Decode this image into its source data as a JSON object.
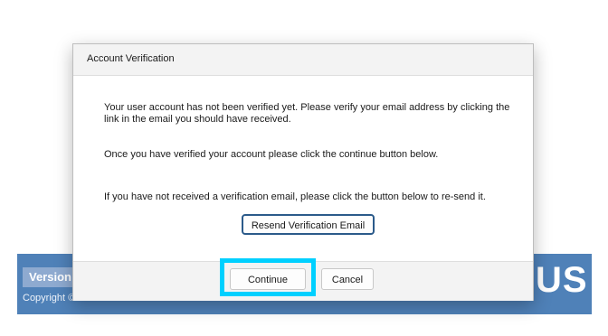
{
  "background_app": {
    "version_label": "Version",
    "copyright_text": "Copyright ©",
    "logo_text": "US"
  },
  "dialog": {
    "title": "Account Verification",
    "message_1": "Your user account has not been verified yet. Please verify your email address by clicking the link in the email you should have received.",
    "message_2": "Once you have verified your account please click the continue button below.",
    "message_3": "If you have not received a verification email, please click the button below to re-send it.",
    "resend_button": "Resend Verification Email",
    "continue_button": "Continue",
    "cancel_button": "Cancel"
  },
  "colors": {
    "focus_highlight": "#00d0ff",
    "background_panel": "#4f81b8",
    "primary_button_border": "#2b5a8a"
  }
}
